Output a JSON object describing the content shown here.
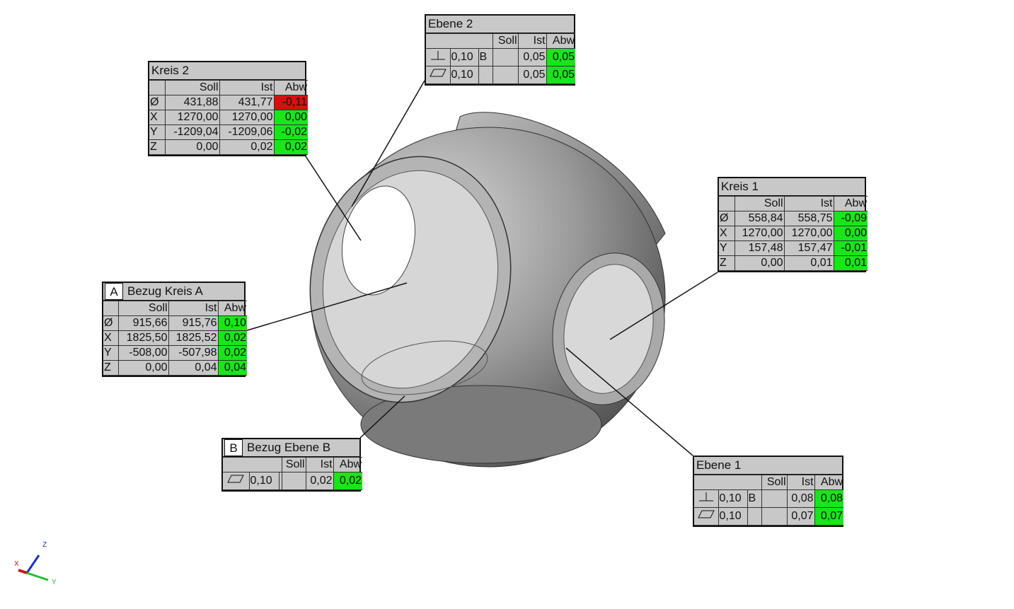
{
  "colors": {
    "ok": "#19e619",
    "out_of_tolerance": "#d51010",
    "panel": "#c8c8c8"
  },
  "circle_tables": [
    {
      "id": "kreis-2",
      "title": "Kreis 2",
      "datum": null,
      "headers": [
        "",
        "Soll",
        "Ist",
        "Abw"
      ],
      "rows": [
        {
          "label": "Ø",
          "soll": "431,88",
          "ist": "431,77",
          "abw": "-0,11",
          "status": "bad"
        },
        {
          "label": "X",
          "soll": "1270,00",
          "ist": "1270,00",
          "abw": "0,00",
          "status": "ok"
        },
        {
          "label": "Y",
          "soll": "-1209,04",
          "ist": "-1209,06",
          "abw": "-0,02",
          "status": "ok"
        },
        {
          "label": "Z",
          "soll": "0,00",
          "ist": "0,02",
          "abw": "0,02",
          "status": "ok"
        }
      ]
    },
    {
      "id": "kreis-1",
      "title": "Kreis 1",
      "datum": null,
      "headers": [
        "",
        "Soll",
        "Ist",
        "Abw"
      ],
      "rows": [
        {
          "label": "Ø",
          "soll": "558,84",
          "ist": "558,75",
          "abw": "-0,09",
          "status": "ok"
        },
        {
          "label": "X",
          "soll": "1270,00",
          "ist": "1270,00",
          "abw": "0,00",
          "status": "ok"
        },
        {
          "label": "Y",
          "soll": "157,48",
          "ist": "157,47",
          "abw": "-0,01",
          "status": "ok"
        },
        {
          "label": "Z",
          "soll": "0,00",
          "ist": "0,01",
          "abw": "0,01",
          "status": "ok"
        }
      ]
    },
    {
      "id": "bezug-kreis-a",
      "title": "Bezug Kreis A",
      "datum": "A",
      "headers": [
        "",
        "Soll",
        "Ist",
        "Abw"
      ],
      "rows": [
        {
          "label": "Ø",
          "soll": "915,66",
          "ist": "915,76",
          "abw": "0,10",
          "status": "ok"
        },
        {
          "label": "X",
          "soll": "1825,50",
          "ist": "1825,52",
          "abw": "0,02",
          "status": "ok"
        },
        {
          "label": "Y",
          "soll": "-508,00",
          "ist": "-507,98",
          "abw": "0,02",
          "status": "ok"
        },
        {
          "label": "Z",
          "soll": "0,00",
          "ist": "0,04",
          "abw": "0,04",
          "status": "ok"
        }
      ]
    }
  ],
  "plane_tables": [
    {
      "id": "ebene-2",
      "title": "Ebene 2",
      "datum": null,
      "headers": [
        "Soll",
        "Ist",
        "Abw"
      ],
      "rows": [
        {
          "symbol": "perpendicularity-icon",
          "tol": "0,10",
          "ref": "B",
          "soll": "",
          "ist": "0,05",
          "abw": "0,05",
          "status": "ok"
        },
        {
          "symbol": "flatness-icon",
          "tol": "0,10",
          "ref": "",
          "soll": "",
          "ist": "0,05",
          "abw": "0,05",
          "status": "ok"
        }
      ]
    },
    {
      "id": "bezug-ebene-b",
      "title": "Bezug Ebene B",
      "datum": "B",
      "headers": [
        "Soll",
        "Ist",
        "Abw"
      ],
      "rows": [
        {
          "symbol": "flatness-icon",
          "tol": "0,10",
          "ref": "",
          "soll": "",
          "ist": "0,02",
          "abw": "0,02",
          "status": "ok"
        }
      ]
    },
    {
      "id": "ebene-1",
      "title": "Ebene 1",
      "datum": null,
      "headers": [
        "Soll",
        "Ist",
        "Abw"
      ],
      "rows": [
        {
          "symbol": "perpendicularity-icon",
          "tol": "0,10",
          "ref": "B",
          "soll": "",
          "ist": "0,08",
          "abw": "0,08",
          "status": "ok"
        },
        {
          "symbol": "flatness-icon",
          "tol": "0,10",
          "ref": "",
          "soll": "",
          "ist": "0,07",
          "abw": "0,07",
          "status": "ok"
        }
      ]
    }
  ],
  "axis_triad": {
    "x": "X",
    "y": "Y",
    "z": "Z"
  }
}
